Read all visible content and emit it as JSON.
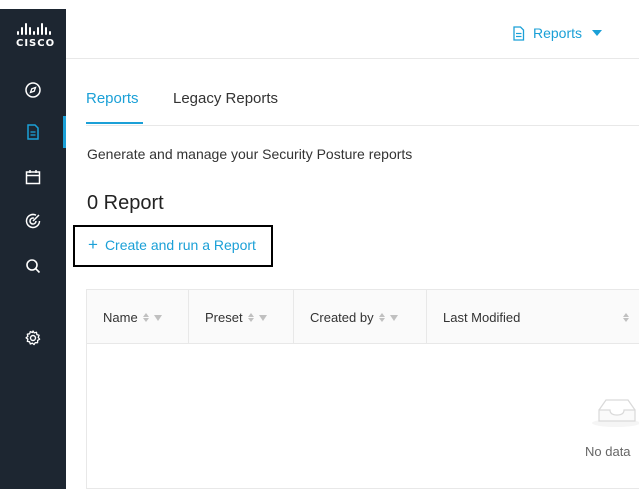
{
  "sidebar": {
    "logo_text": "CISCO",
    "items": [
      {
        "icon": "compass-icon",
        "label": "Explore"
      },
      {
        "icon": "report-icon",
        "label": "Reports",
        "active": true
      },
      {
        "icon": "calendar-icon",
        "label": "Calendar"
      },
      {
        "icon": "target-icon",
        "label": "Targets"
      },
      {
        "icon": "search-icon",
        "label": "Search"
      },
      {
        "icon": "gear-icon",
        "label": "Settings"
      }
    ]
  },
  "header": {
    "menu_label": "Reports"
  },
  "tabs": [
    {
      "label": "Reports",
      "active": true
    },
    {
      "label": "Legacy Reports",
      "active": false
    }
  ],
  "page": {
    "subtitle": "Generate and manage your Security Posture reports",
    "count_label": "0 Report",
    "create_label": "Create and run a Report"
  },
  "table": {
    "columns": [
      {
        "label": "Name",
        "sortable": true,
        "filterable": true
      },
      {
        "label": "Preset",
        "sortable": true,
        "filterable": true
      },
      {
        "label": "Created by",
        "sortable": true,
        "filterable": true
      },
      {
        "label": "Last Modified",
        "sortable": true,
        "filterable": false
      }
    ],
    "empty_text": "No data"
  },
  "colors": {
    "accent": "#1ba0d7",
    "sidebar_bg": "#1d2631"
  }
}
